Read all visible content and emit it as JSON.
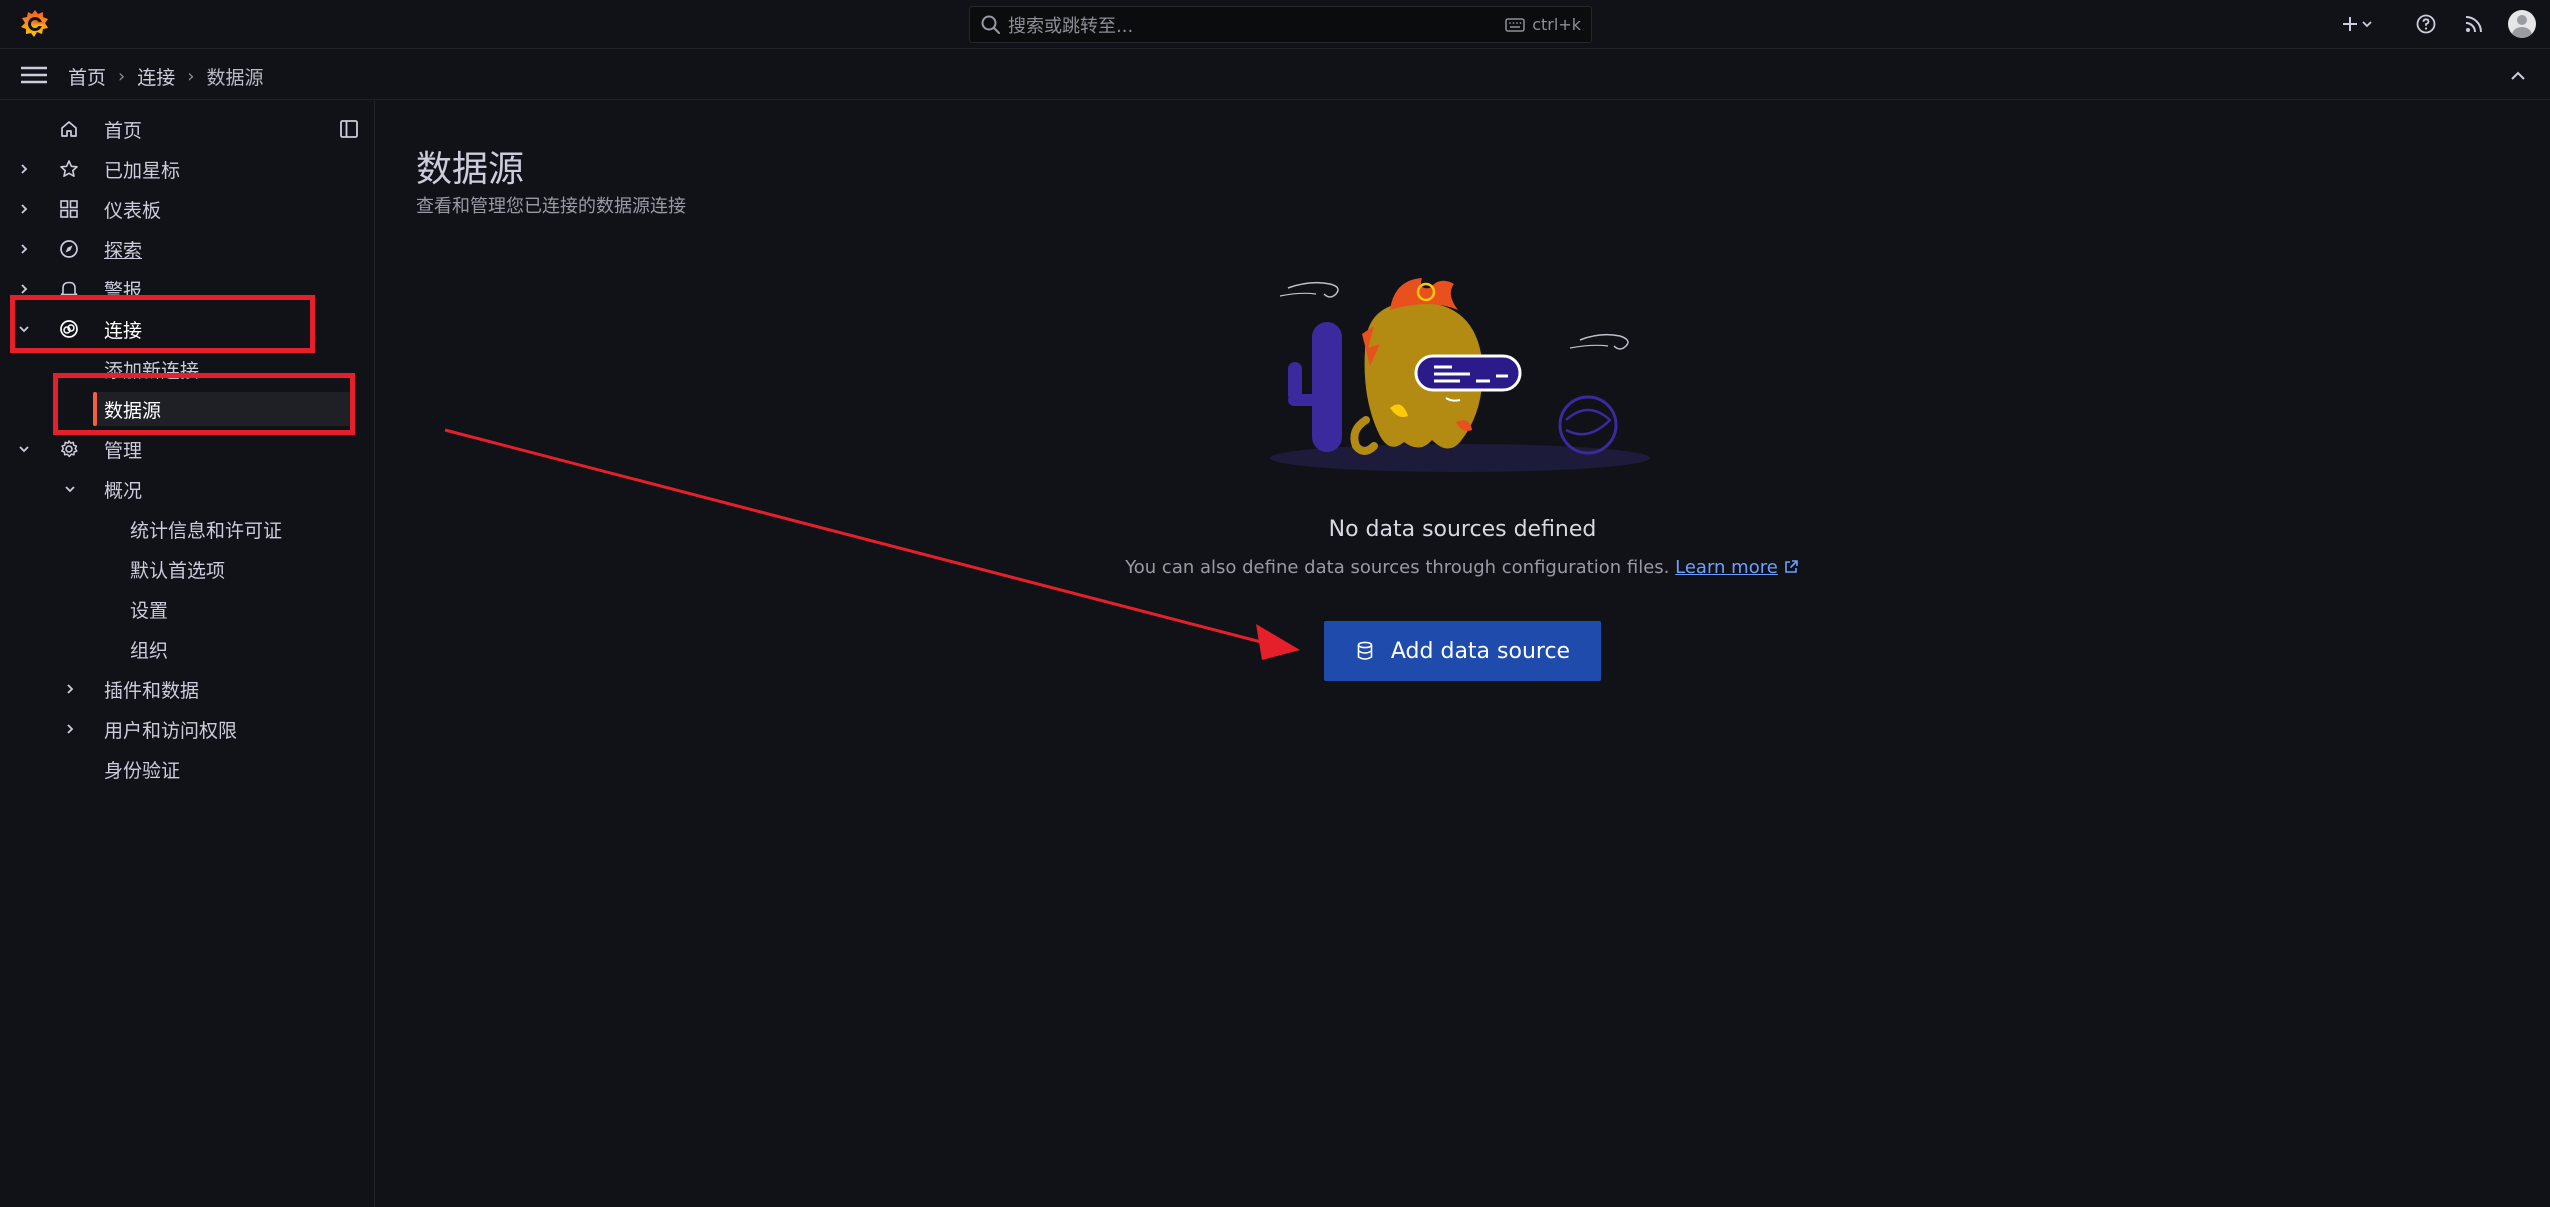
{
  "topbar": {
    "search": {
      "placeholder": "搜索或跳转至...",
      "shortcut": "ctrl+k"
    },
    "icons": [
      "grafana-logo-icon",
      "search-icon",
      "keyboard-icon",
      "plus-icon",
      "chevron-down-icon",
      "help-icon",
      "rss-icon",
      "avatar"
    ]
  },
  "breadcrumb": [
    "首页",
    "连接",
    "数据源"
  ],
  "sidebar": {
    "items": [
      {
        "label": "首页",
        "icon": "home-icon"
      },
      {
        "label": "已加星标",
        "icon": "star-icon"
      },
      {
        "label": "仪表板",
        "icon": "apps-icon"
      },
      {
        "label": "探索",
        "icon": "compass-icon"
      },
      {
        "label": "警报",
        "icon": "bell-icon"
      },
      {
        "label": "连接",
        "icon": "link-icon"
      },
      {
        "label": "添加新连接"
      },
      {
        "label": "数据源"
      },
      {
        "label": "管理",
        "icon": "cog-icon"
      },
      {
        "label": "概况"
      },
      {
        "label": "统计信息和许可证"
      },
      {
        "label": "默认首选项"
      },
      {
        "label": "设置"
      },
      {
        "label": "组织"
      },
      {
        "label": "插件和数据"
      },
      {
        "label": "用户和访问权限"
      },
      {
        "label": "身份验证"
      }
    ]
  },
  "main": {
    "title": "数据源",
    "subtitle": "查看和管理您已连接的数据源连接",
    "empty": {
      "title": "No data sources defined",
      "text": "You can also define data sources through configuration files.",
      "link": "Learn more",
      "button": "Add data source"
    }
  },
  "colors": {
    "background": "#111217",
    "primary_button": "#1f4bad",
    "link": "#6e9fff",
    "active_indicator": "#f55f3e",
    "annotation_red": "#e5202a"
  }
}
